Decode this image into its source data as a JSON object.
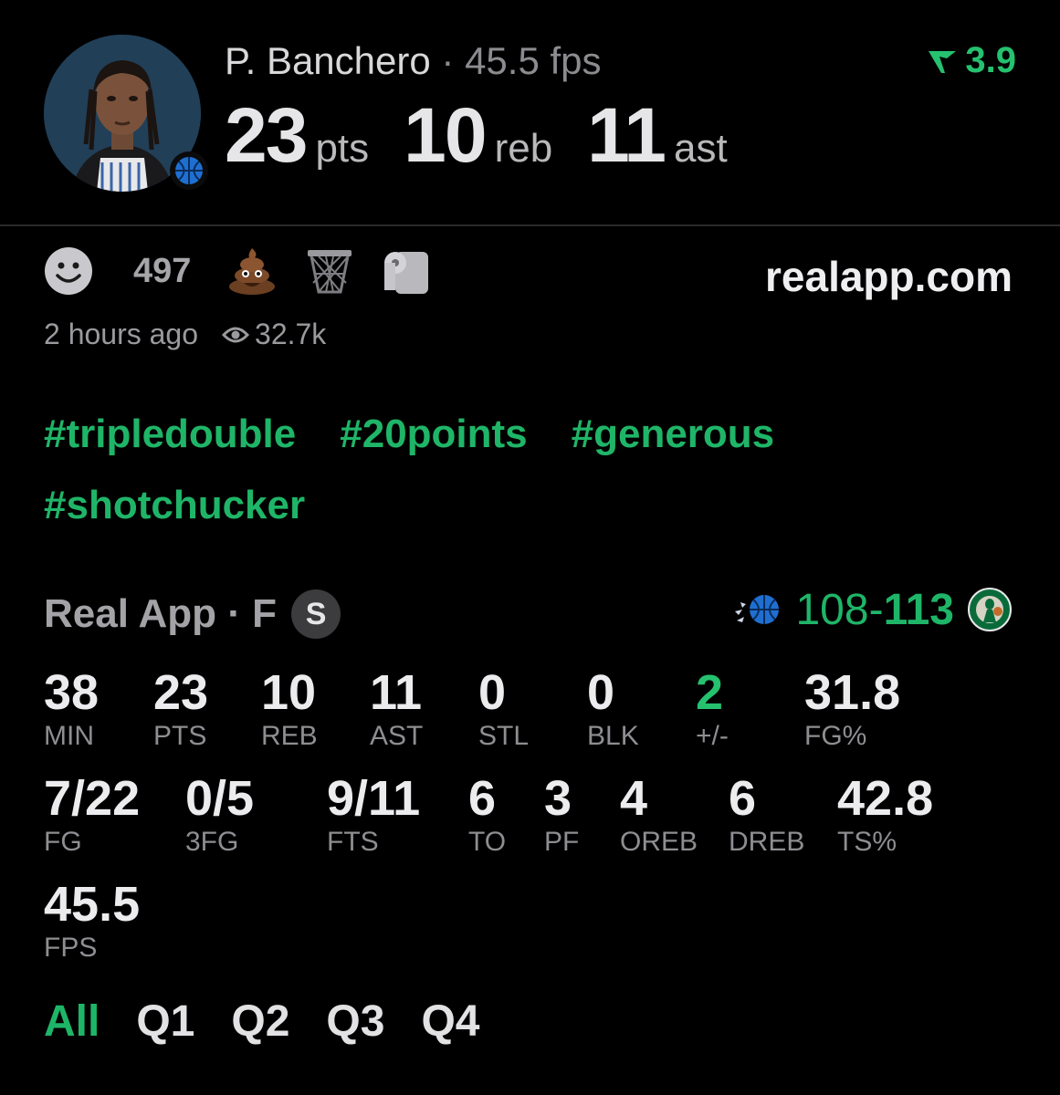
{
  "player": {
    "name": "P. Banchero",
    "separator": "·",
    "fps_text": "45.5 fps",
    "rating": "3.9",
    "big_stats": [
      {
        "value": "23",
        "unit": "pts"
      },
      {
        "value": "10",
        "unit": "reb"
      },
      {
        "value": "11",
        "unit": "ast"
      }
    ]
  },
  "reactions": {
    "smile_count": "497",
    "icons": [
      "smile-icon",
      "poop-icon",
      "basketball-net-icon",
      "toilet-paper-icon"
    ]
  },
  "site": "realapp.com",
  "meta": {
    "time_ago": "2 hours ago",
    "views": "32.7k"
  },
  "hashtags": [
    "#tripledouble",
    "#20points",
    "#generous",
    "#shotchucker"
  ],
  "game": {
    "source": "Real App · F",
    "badge": "S",
    "home_score": "108",
    "dash": "-",
    "away_score": "113"
  },
  "stats": [
    {
      "value": "38",
      "label": "MIN"
    },
    {
      "value": "23",
      "label": "PTS"
    },
    {
      "value": "10",
      "label": "REB"
    },
    {
      "value": "11",
      "label": "AST"
    },
    {
      "value": "0",
      "label": "STL"
    },
    {
      "value": "0",
      "label": "BLK"
    },
    {
      "value": "2",
      "label": "+/-"
    },
    {
      "value": "31.8",
      "label": "FG%"
    },
    {
      "value": "7/22",
      "label": "FG"
    },
    {
      "value": "0/5",
      "label": "3FG"
    },
    {
      "value": "9/11",
      "label": "FTS"
    },
    {
      "value": "6",
      "label": "TO"
    },
    {
      "value": "3",
      "label": "PF"
    },
    {
      "value": "4",
      "label": "OREB"
    },
    {
      "value": "6",
      "label": "DREB"
    },
    {
      "value": "42.8",
      "label": "TS%"
    },
    {
      "value": "45.5",
      "label": "FPS"
    }
  ],
  "tabs": [
    "All",
    "Q1",
    "Q2",
    "Q3",
    "Q4"
  ],
  "colors": {
    "accent_green": "#1fb568",
    "background": "#000000"
  }
}
